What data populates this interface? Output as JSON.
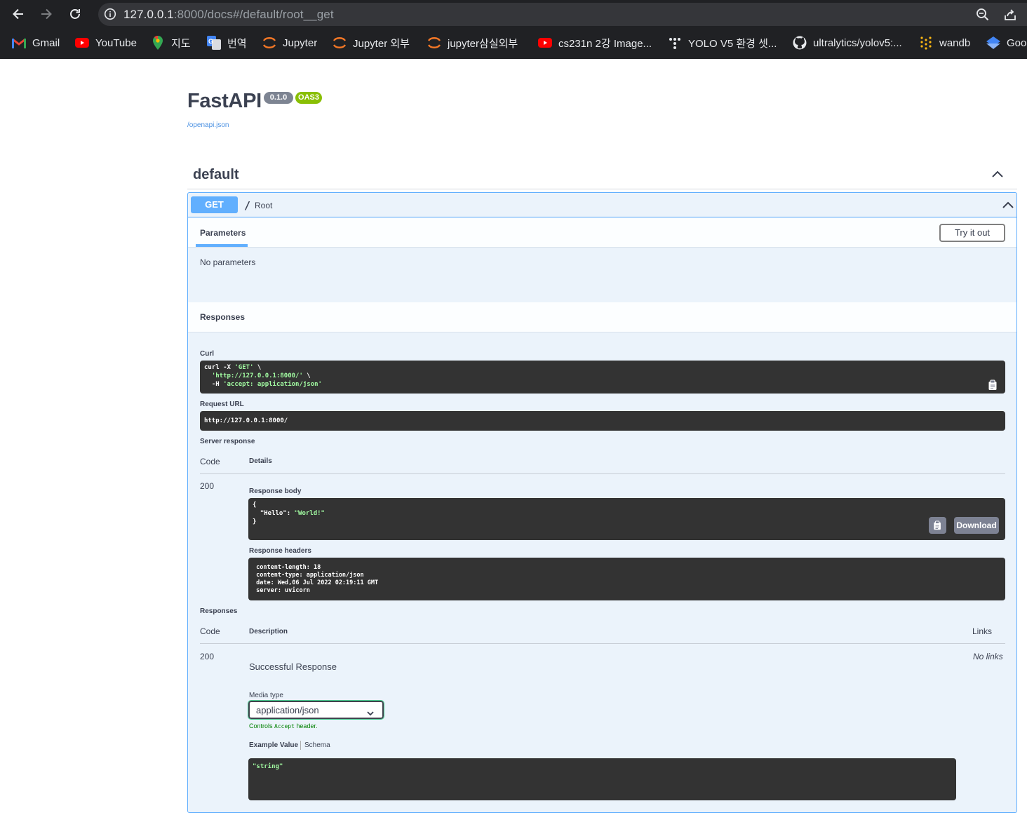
{
  "browser": {
    "url_host": "127.0.0.1",
    "url_rest": ":8000/docs#/default/root__get",
    "bookmarks": [
      {
        "label": "Gmail",
        "icon": "gmail-icon"
      },
      {
        "label": "YouTube",
        "icon": "youtube-icon"
      },
      {
        "label": "지도",
        "icon": "maps-icon"
      },
      {
        "label": "번역",
        "icon": "translate-icon"
      },
      {
        "label": "Jupyter",
        "icon": "jupyter-icon"
      },
      {
        "label": "Jupyter 외부",
        "icon": "jupyter-icon"
      },
      {
        "label": "jupyter삼실외부",
        "icon": "jupyter-icon"
      },
      {
        "label": "cs231n 2강 Image...",
        "icon": "youtube-icon"
      },
      {
        "label": "YOLO V5 환경 셋...",
        "icon": "dots-icon"
      },
      {
        "label": "ultralytics/yolov5:...",
        "icon": "github-icon"
      },
      {
        "label": "wandb",
        "icon": "wandb-icon"
      },
      {
        "label": "Goo",
        "icon": "google-icon"
      }
    ]
  },
  "api": {
    "title": "FastAPI",
    "version": "0.1.0",
    "oas": "OAS3",
    "spec_url": "/openapi.json"
  },
  "tag": {
    "name": "default"
  },
  "operation": {
    "method": "GET",
    "path": "/",
    "summary": "Root",
    "params_tab": "Parameters",
    "try_out": "Try it out",
    "no_params": "No parameters",
    "responses_title": "Responses"
  },
  "execution": {
    "curl_label": "Curl",
    "curl_line1_cmd": "curl -X ",
    "curl_line1_str": "'GET'",
    "curl_line1_end": " \\",
    "curl_line2_str": "'http://127.0.0.1:8000/'",
    "curl_line2_end": " \\",
    "curl_line3_cmd": "  -H ",
    "curl_line3_str": "'accept: application/json'",
    "request_url_label": "Request URL",
    "request_url": "http://127.0.0.1:8000/",
    "server_response_label": "Server response",
    "code_header": "Code",
    "details_header": "Details",
    "code": "200",
    "response_body_label": "Response body",
    "body_open": "{",
    "body_key": "  \"Hello\": ",
    "body_val": "\"World!\"",
    "body_close": "}",
    "download": "Download",
    "response_headers_label": "Response headers",
    "headers": " content-length: 18 \n content-type: application/json \n date: Wed,06 Jul 2022 02:19:11 GMT \n server: uvicorn "
  },
  "responses": {
    "label": "Responses",
    "code_header": "Code",
    "description_header": "Description",
    "links_header": "Links",
    "code": "200",
    "description": "Successful Response",
    "no_links": "No links",
    "media_type_label": "Media type",
    "media_type": "application/json",
    "controls_prefix": "Controls ",
    "controls_code": "Accept",
    "controls_suffix": " header.",
    "example_value_tab": "Example Value",
    "schema_tab": "Schema",
    "example": "\"string\""
  }
}
